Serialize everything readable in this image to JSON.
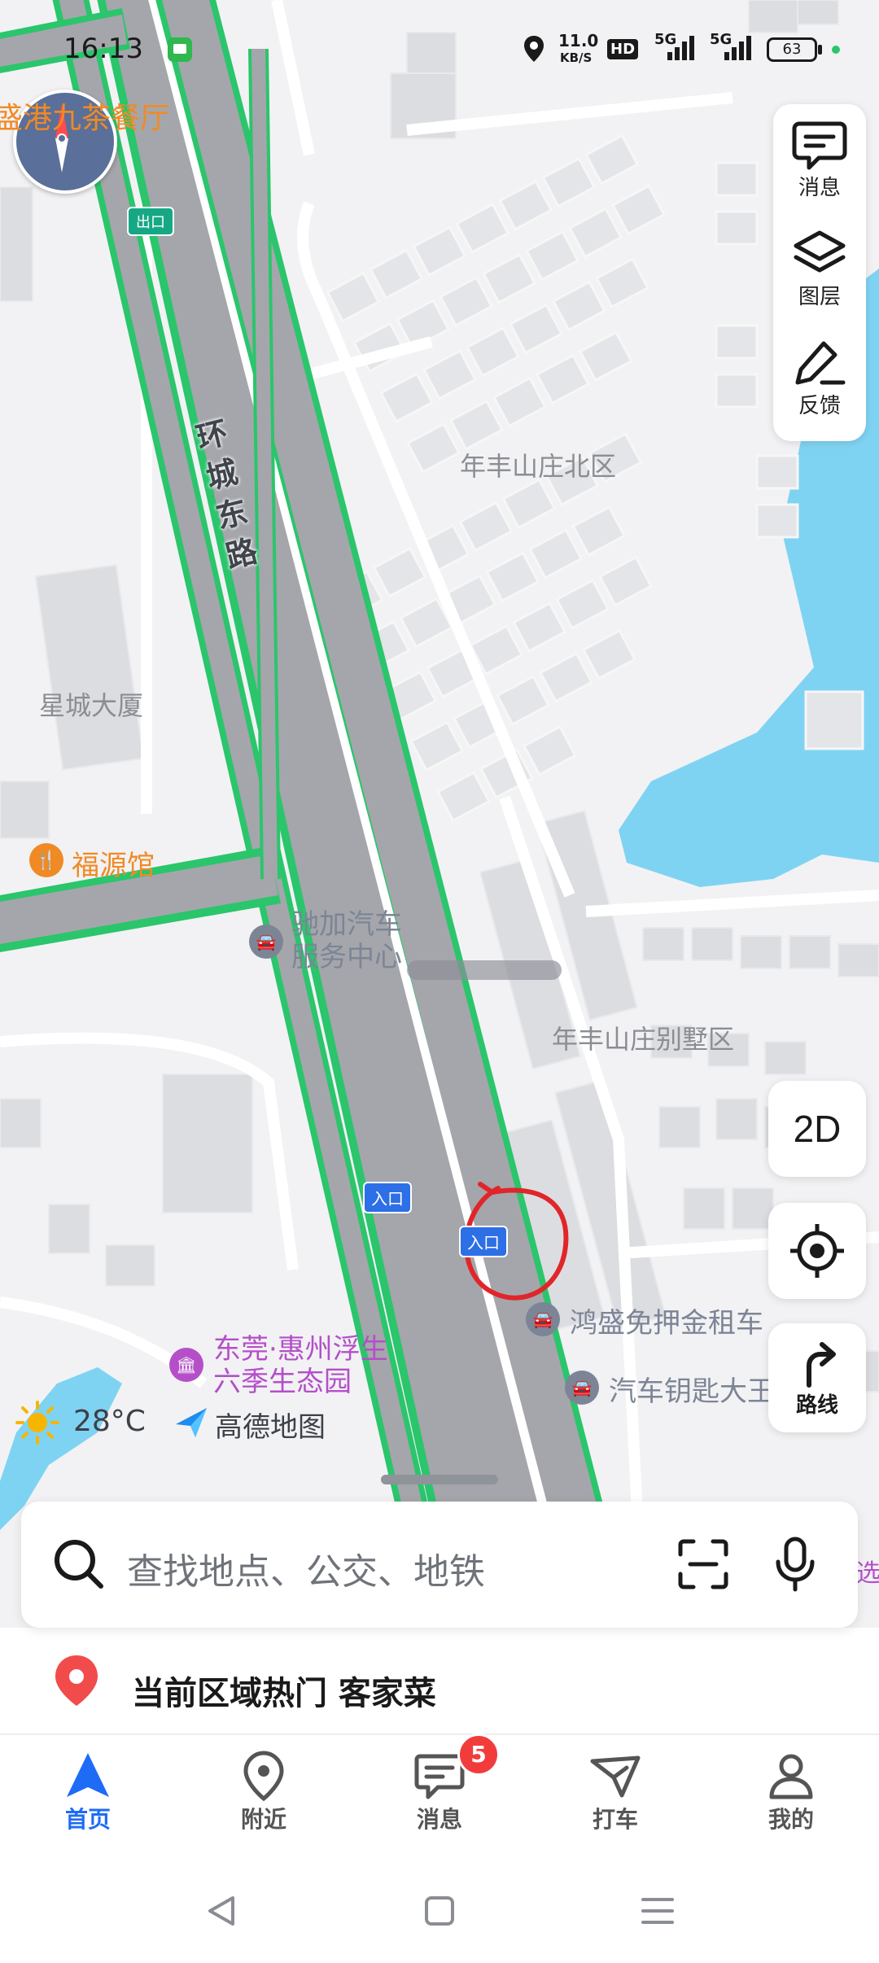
{
  "status_bar": {
    "time": "16:13",
    "net_speed_value": "11.0",
    "net_speed_unit": "KB/S",
    "hd_label": "HD",
    "sim1_label": "5G",
    "sim2_label": "5G",
    "battery": "63"
  },
  "map": {
    "labels": {
      "restaurant_top": "盛港九茶餐厅",
      "exit_sign": "出口",
      "road_name": [
        "环",
        "城",
        "东",
        "路"
      ],
      "area_north": "年丰山庄北区",
      "building": "星城大厦",
      "restaurant": "福源馆",
      "car_service": "驰加汽车\n服务中心",
      "villa_area": "年丰山庄别墅区",
      "entrance_1": "入口",
      "entrance_2": "入口",
      "car_rental": "鸿盛免押金租车",
      "car_key": "汽车钥匙大王",
      "scenic": "东莞·惠州浮生\n六季生态园",
      "temperature": "28°C",
      "brand": "高德地图",
      "right_edge_text": "选"
    }
  },
  "tools": {
    "messages": "消息",
    "layers": "图层",
    "feedback": "反馈"
  },
  "map_controls": {
    "mode_2d": "2D",
    "route": "路线"
  },
  "search": {
    "placeholder": "查找地点、公交、地铁"
  },
  "hot": {
    "text": "当前区域热门 客家菜"
  },
  "bottom_nav": {
    "items": [
      {
        "label": "首页",
        "active": true
      },
      {
        "label": "附近",
        "active": false
      },
      {
        "label": "消息",
        "active": false,
        "badge": "5"
      },
      {
        "label": "打车",
        "active": false
      },
      {
        "label": "我的",
        "active": false
      }
    ]
  },
  "colors": {
    "accent": "#1e6cf6",
    "road_edge": "#28c76f",
    "water": "#7fd3f2",
    "poi_orange": "#f08a24",
    "poi_gray": "#7c8596",
    "poi_purple": "#b44fc9",
    "badge_red": "#f23c3c",
    "annotation_red": "#e0262a"
  }
}
